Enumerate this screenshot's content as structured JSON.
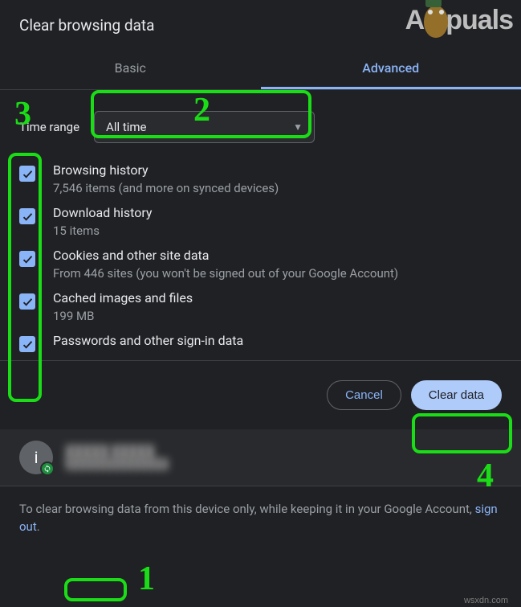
{
  "dialog": {
    "title": "Clear browsing data"
  },
  "tabs": {
    "basic": "Basic",
    "advanced": "Advanced",
    "active": "advanced"
  },
  "time_range": {
    "label": "Time range",
    "value": "All time"
  },
  "options": [
    {
      "title": "Browsing history",
      "sub": "7,546 items (and more on synced devices)",
      "checked": true
    },
    {
      "title": "Download history",
      "sub": "15 items",
      "checked": true
    },
    {
      "title": "Cookies and other site data",
      "sub": "From 446 sites (you won't be signed out of your Google Account)",
      "checked": true
    },
    {
      "title": "Cached images and files",
      "sub": "199 MB",
      "checked": true
    },
    {
      "title": "Passwords and other sign-in data",
      "sub": "",
      "checked": true
    }
  ],
  "buttons": {
    "cancel": "Cancel",
    "clear": "Clear data"
  },
  "account": {
    "avatar_letter": "i",
    "masked_name": "█████ █████",
    "masked_email": "███████████████"
  },
  "note": {
    "pre": "To clear browsing data from this device only, while keeping it in your Google Account, ",
    "link": "sign out",
    "post": "."
  },
  "annotations": {
    "n1": "1",
    "n2": "2",
    "n3": "3",
    "n4": "4"
  },
  "watermarks": {
    "top_pre": "A",
    "top_post": "puals",
    "bottom": "wsxdn.com"
  }
}
